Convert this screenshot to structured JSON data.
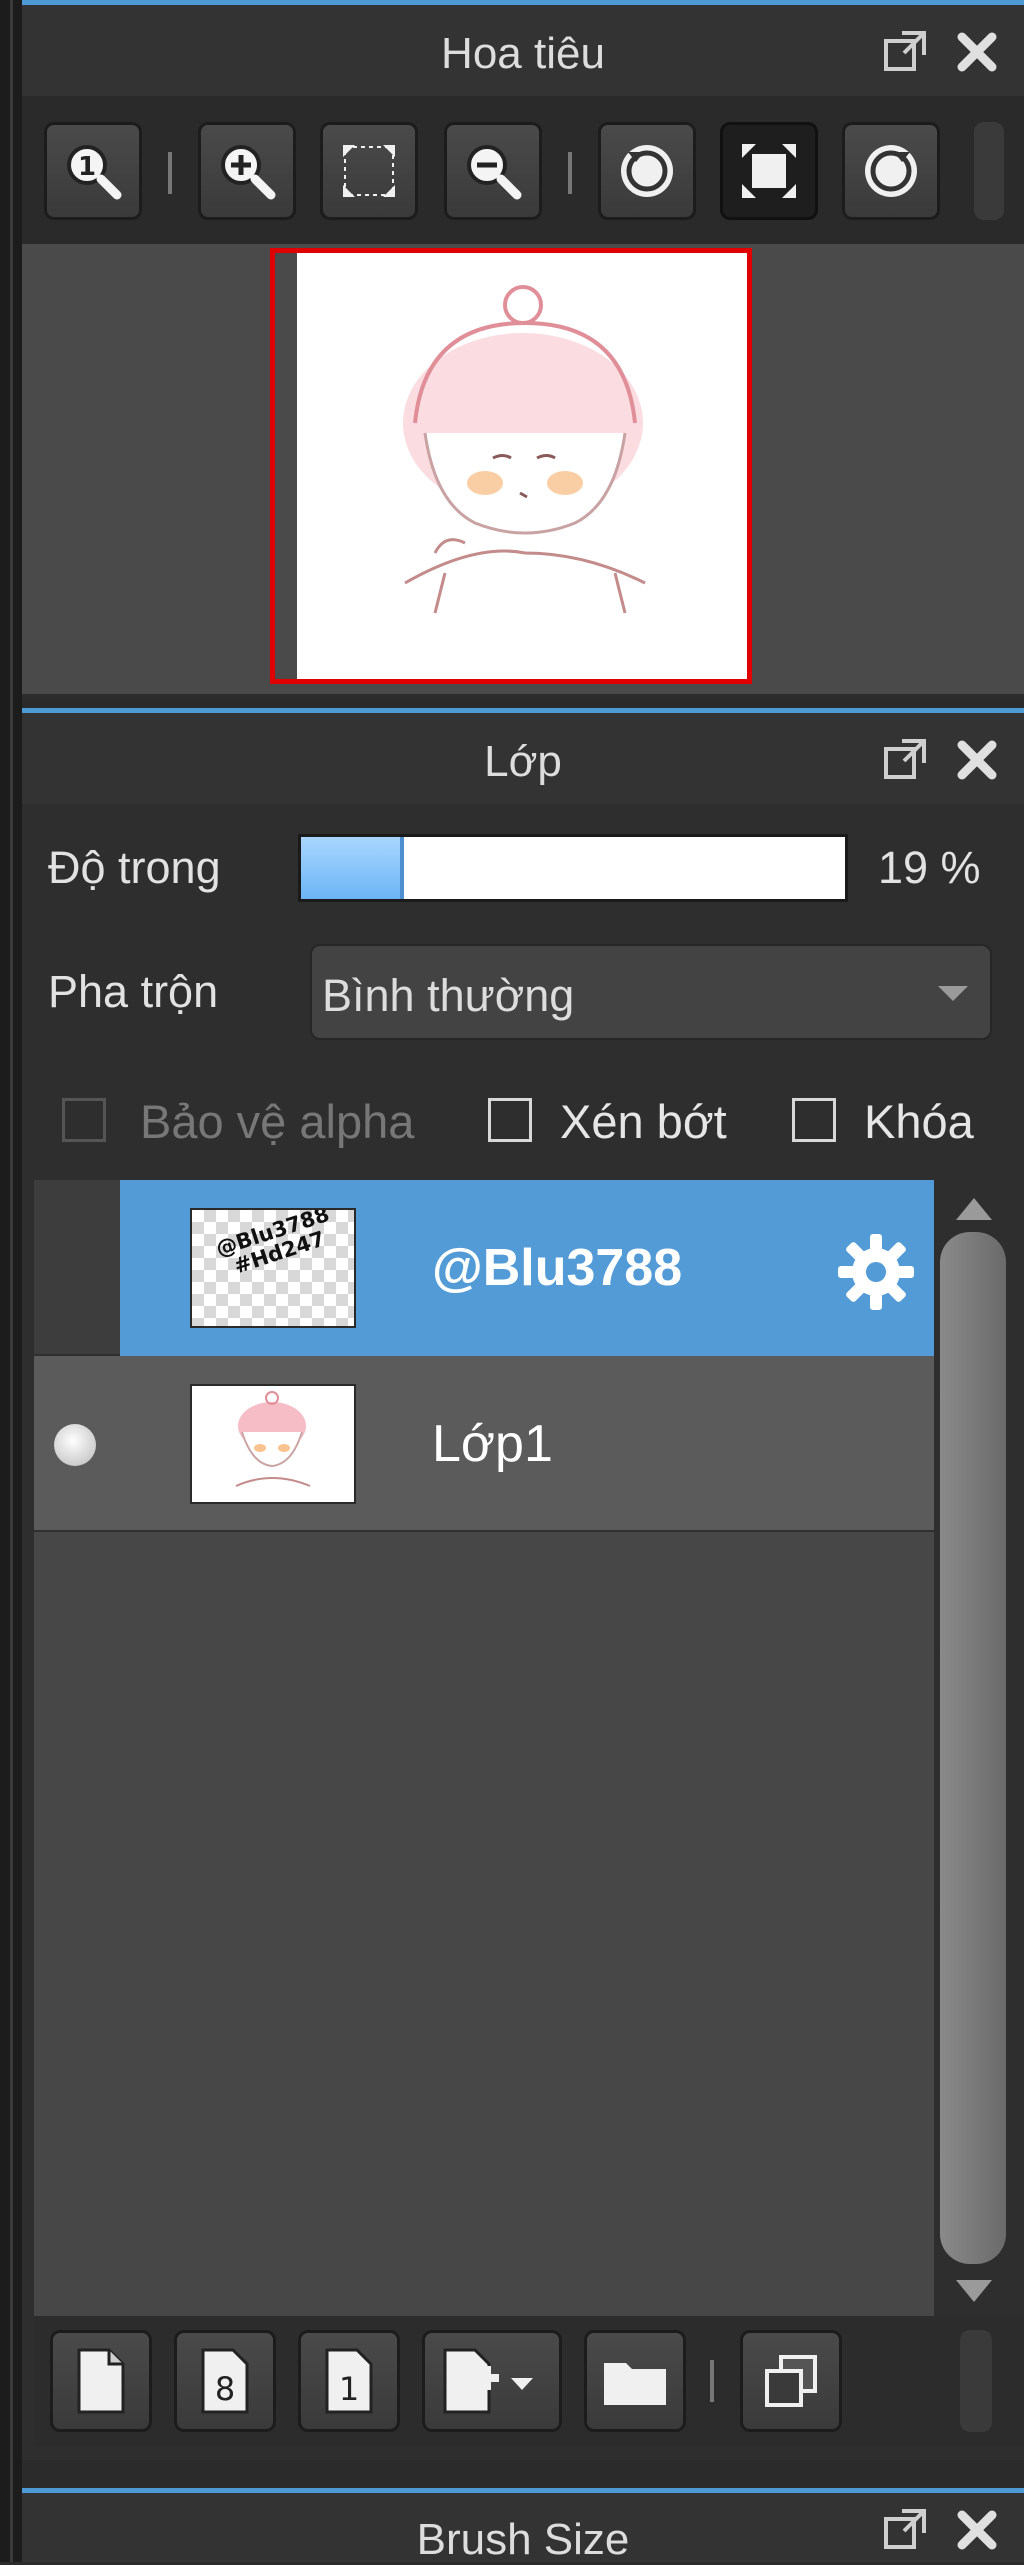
{
  "navigator": {
    "title": "Hoa tiêu",
    "toolbar": {
      "buttons": [
        "zoom-actual-icon",
        "zoom-in-icon",
        "fit-screen-icon",
        "zoom-out-icon",
        "rotate-left-icon",
        "fullscreen-icon",
        "rotate-right-icon"
      ]
    }
  },
  "layers": {
    "title": "Lớp",
    "opacity_label": "Độ trong",
    "opacity_percent": 19,
    "opacity_text": "19 %",
    "blend_label": "Pha trộn",
    "blend_value": "Bình thường",
    "alpha_protect_label": "Bảo vệ alpha",
    "clip_label": "Xén bớt",
    "lock_label": "Khóa",
    "items": [
      {
        "name": "@Blu3788",
        "thumb_text": "@Blu3788 #Hd247",
        "selected": true
      },
      {
        "name": "Lớp1",
        "selected": false
      }
    ]
  },
  "brush_size": {
    "title": "Brush Size"
  },
  "colors": {
    "accent": "#4d9ad4",
    "selection": "#529bd6",
    "frame": "#e00000"
  }
}
